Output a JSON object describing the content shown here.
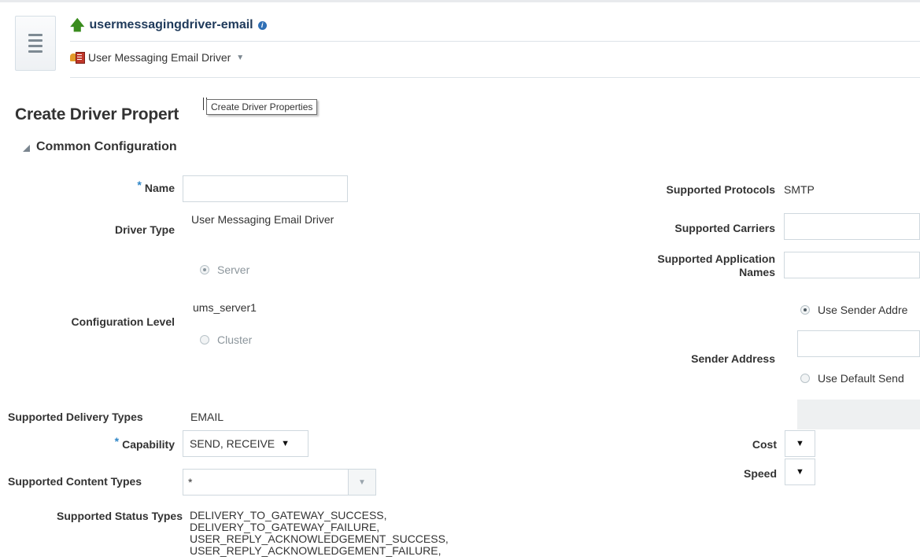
{
  "header": {
    "target_name": "usermessagingdriver-email",
    "target_type_menu": "User Messaging Email Driver"
  },
  "page": {
    "title": "Create Driver Propert",
    "tooltip": "Create Driver Properties"
  },
  "section": {
    "title": "Common Configuration"
  },
  "form": {
    "name_label": "Name",
    "name_value": "",
    "driver_type_label": "Driver Type",
    "driver_type_value": "User Messaging Email Driver",
    "configuration_level_label": "Configuration Level",
    "server_option": "Server",
    "server_name": "ums_server1",
    "cluster_option": "Cluster",
    "supported_delivery_types_label": "Supported Delivery Types",
    "supported_delivery_types_value": "EMAIL",
    "capability_label": "Capability",
    "capability_value": "SEND, RECEIVE",
    "supported_content_types_label": "Supported Content Types",
    "supported_content_types_value": "*",
    "supported_status_types_label": "Supported Status Types",
    "supported_status_types": [
      "DELIVERY_TO_GATEWAY_SUCCESS,",
      "DELIVERY_TO_GATEWAY_FAILURE,",
      "USER_REPLY_ACKNOWLEDGEMENT_SUCCESS,",
      "USER_REPLY_ACKNOWLEDGEMENT_FAILURE,"
    ],
    "supported_protocols_label": "Supported Protocols",
    "supported_protocols_value": "SMTP",
    "supported_carriers_label": "Supported Carriers",
    "supported_application_names_label_1": "Supported Application",
    "supported_application_names_label_2": "Names",
    "sender_address_label": "Sender Address",
    "use_sender_address_option": "Use Sender Addre",
    "use_default_sender_option": "Use Default Send",
    "cost_label": "Cost",
    "speed_label": "Speed"
  },
  "colors": {
    "accent": "#2f86c7",
    "title": "#1f3a5b",
    "up_arrow": "#3a8c1e"
  }
}
